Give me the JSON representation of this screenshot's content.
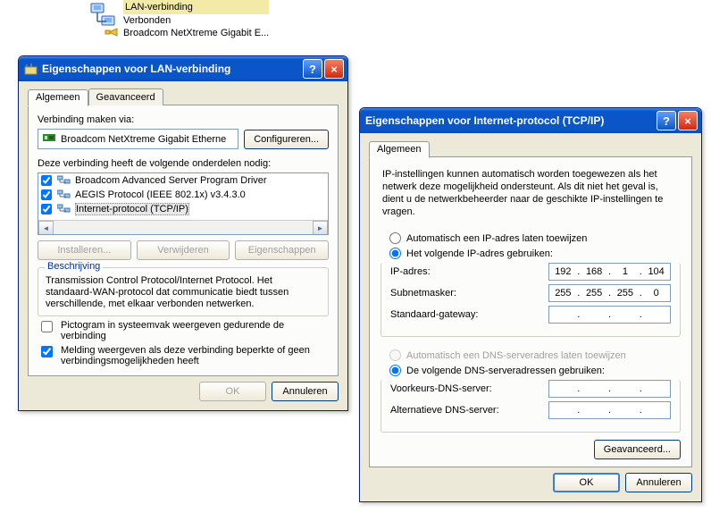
{
  "desktop_icon": {
    "line1": "LAN-verbinding",
    "line2": "Verbonden",
    "line3": "Broadcom NetXtreme Gigabit E..."
  },
  "dlg1": {
    "title": "Eigenschappen voor LAN-verbinding",
    "tab1": "Algemeen",
    "tab2": "Geavanceerd",
    "connect_via_lbl": "Verbinding maken via:",
    "adapter": "Broadcom NetXtreme Gigabit Etherne",
    "configure_btn": "Configureren...",
    "components_lbl": "Deze verbinding heeft de volgende onderdelen nodig:",
    "items": [
      "Broadcom Advanced Server Program Driver",
      "AEGIS Protocol (IEEE 802.1x) v3.4.3.0",
      "Internet-protocol (TCP/IP)"
    ],
    "install_btn": "Installeren...",
    "remove_btn": "Verwijderen",
    "props_btn": "Eigenschappen",
    "desc_legend": "Beschrijving",
    "desc_text": "Transmission Control Protocol/Internet Protocol. Het standaard-WAN-protocol dat communicatie biedt tussen verschillende, met elkaar verbonden netwerken.",
    "chk1": "Pictogram in systeemvak weergeven gedurende de verbinding",
    "chk2": "Melding weergeven als deze verbinding beperkte of geen verbindingsmogelijkheden heeft",
    "ok": "OK",
    "cancel": "Annuleren"
  },
  "dlg2": {
    "title": "Eigenschappen voor Internet-protocol (TCP/IP)",
    "tab1": "Algemeen",
    "intro": "IP-instellingen kunnen automatisch worden toegewezen als het netwerk deze mogelijkheid ondersteunt. Als dit niet het geval is, dient u de netwerkbeheerder naar de geschikte IP-instellingen te vragen.",
    "r1": "Automatisch een IP-adres laten toewijzen",
    "r2": "Het volgende IP-adres gebruiken:",
    "ip_lbl": "IP-adres:",
    "ip": [
      "192",
      "168",
      "1",
      "104"
    ],
    "mask_lbl": "Subnetmasker:",
    "mask": [
      "255",
      "255",
      "255",
      "0"
    ],
    "gw_lbl": "Standaard-gateway:",
    "gw": [
      "",
      "",
      "",
      ""
    ],
    "r3": "Automatisch een DNS-serveradres laten toewijzen",
    "r4": "De volgende DNS-serveradressen gebruiken:",
    "dns1_lbl": "Voorkeurs-DNS-server:",
    "dns1": [
      "",
      "",
      "",
      ""
    ],
    "dns2_lbl": "Alternatieve DNS-server:",
    "dns2": [
      "",
      "",
      "",
      ""
    ],
    "adv_btn": "Geavanceerd...",
    "ok": "OK",
    "cancel": "Annuleren"
  }
}
